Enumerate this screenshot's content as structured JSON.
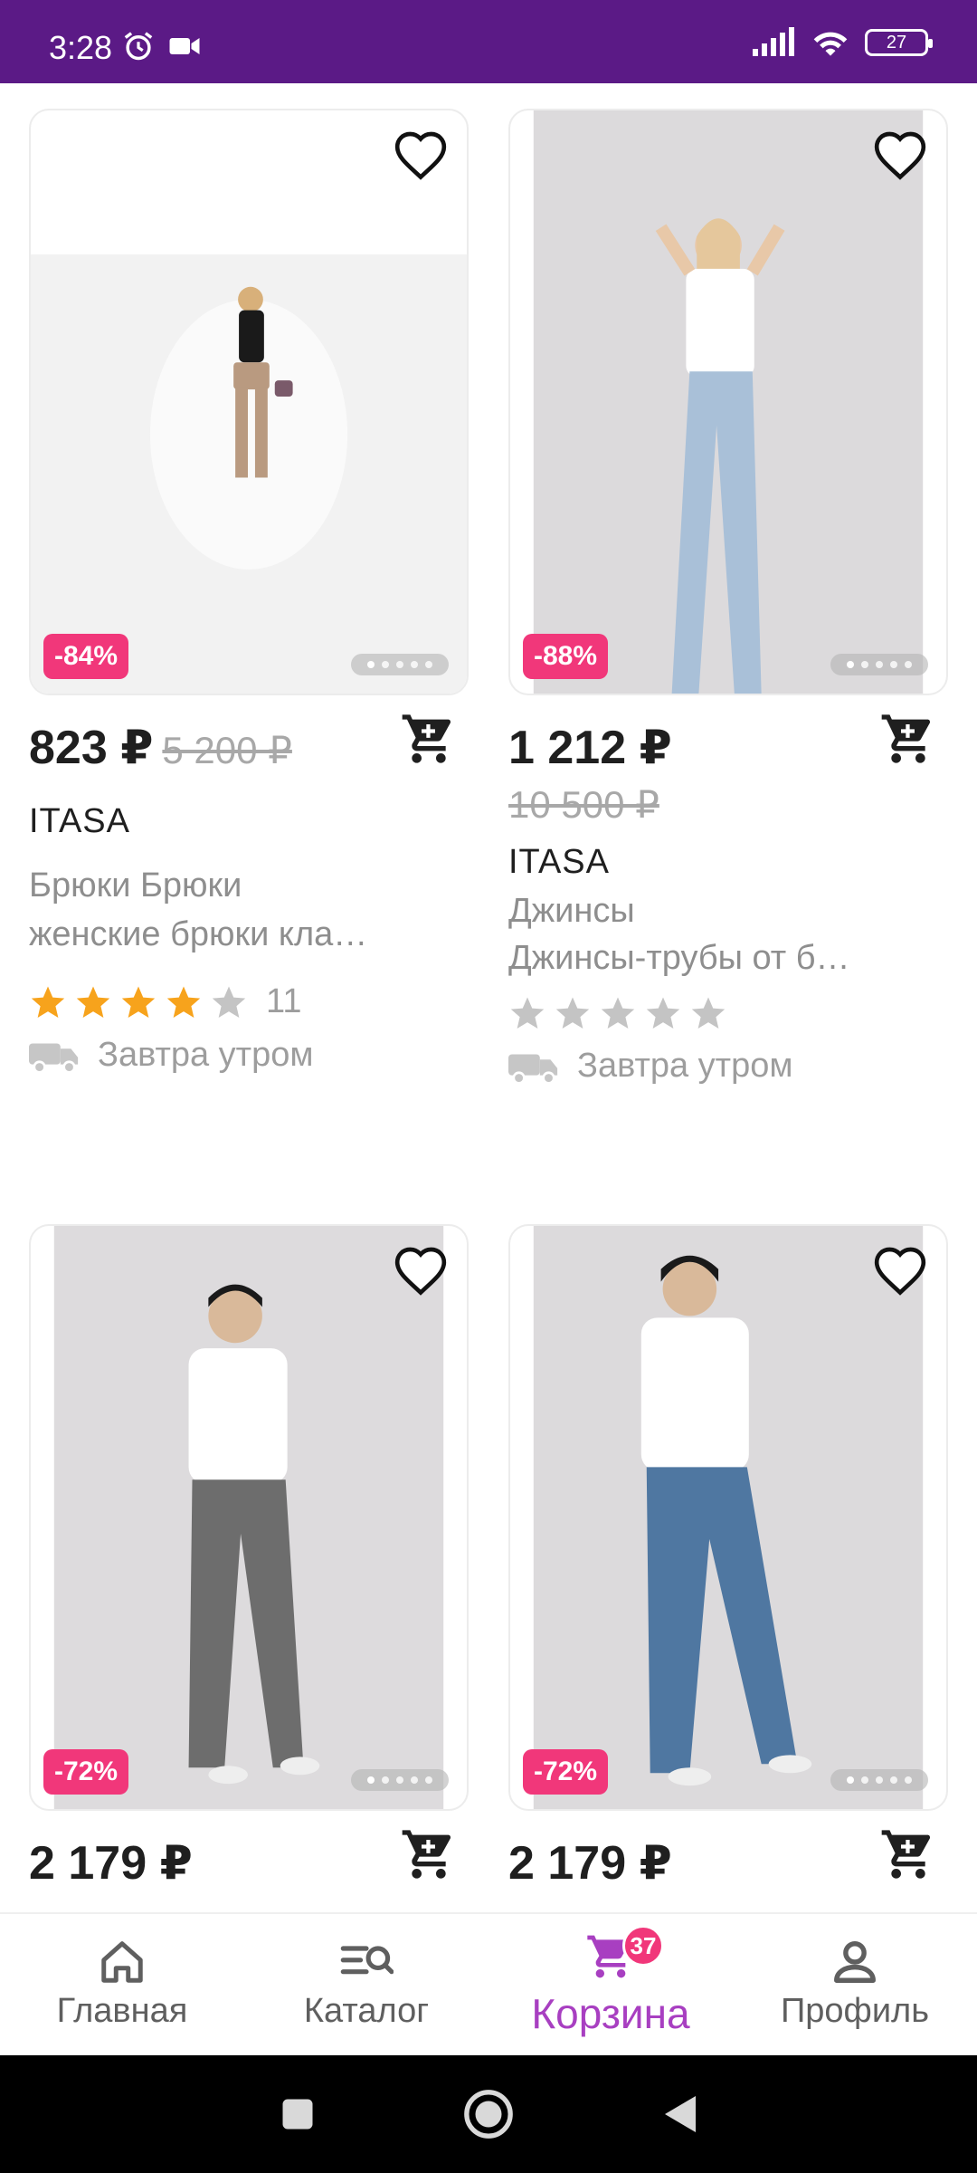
{
  "status_bar": {
    "time": "3:28",
    "battery": "27",
    "background": "#5b1a86"
  },
  "products": [
    {
      "price": "823 ₽",
      "old_price": "5 200 ₽",
      "discount": "-84%",
      "brand": "ITASA",
      "desc_line1": "Брюки Брюки",
      "desc_line2": "женские брюки кла…",
      "rating": 4,
      "reviews": "11",
      "delivery": "Завтра утром"
    },
    {
      "price": "1 212 ₽",
      "old_price": "10 500 ₽",
      "discount": "-88%",
      "brand": "ITASA",
      "desc_line1": "Джинсы",
      "desc_line2": "Джинсы-трубы от б…",
      "rating": 0,
      "delivery": "Завтра утром"
    },
    {
      "price": "2 179 ₽",
      "discount": "-72%"
    },
    {
      "price": "2 179 ₽",
      "discount": "-72%"
    }
  ],
  "bottom_nav": {
    "items": [
      {
        "label": "Главная",
        "icon": "home-icon"
      },
      {
        "label": "Каталог",
        "icon": "catalog-search-icon"
      },
      {
        "label": "Корзина",
        "icon": "cart-icon",
        "badge": "37",
        "active": true
      },
      {
        "label": "Профиль",
        "icon": "profile-icon"
      }
    ]
  },
  "colors": {
    "accent": "#a83fc1",
    "discount": "#f1377a",
    "star": "#f7a31c",
    "star_empty": "#c4c4c4"
  }
}
